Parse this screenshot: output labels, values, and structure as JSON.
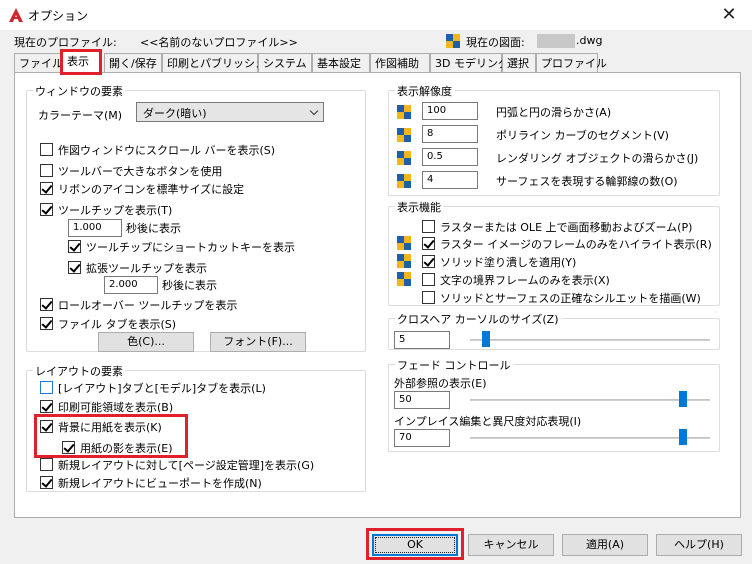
{
  "window": {
    "title": "オプション",
    "close_glyph": "✕"
  },
  "profile": {
    "label": "現在のプロファイル:",
    "value": "<<名前のないプロファイル>>",
    "drawing_label": "現在の図面:",
    "drawing_value": ".dwg"
  },
  "tabs": [
    {
      "label": "ファイル"
    },
    {
      "label": "表示"
    },
    {
      "label": "開く/保存"
    },
    {
      "label": "印刷とパブリッシュ"
    },
    {
      "label": "システム"
    },
    {
      "label": "基本設定"
    },
    {
      "label": "作図補助"
    },
    {
      "label": "3D モデリング"
    },
    {
      "label": "選択"
    },
    {
      "label": "プロファイル"
    }
  ],
  "window_elements": {
    "title": "ウィンドウの要素",
    "color_theme_label": "カラーテーマ(M)",
    "color_theme_value": "ダーク(暗い)",
    "items": [
      {
        "label": "作図ウィンドウにスクロール バーを表示(S)",
        "checked": false
      },
      {
        "label": "ツールバーで大きなボタンを使用",
        "checked": false
      },
      {
        "label": "リボンのアイコンを標準サイズに設定",
        "checked": true
      },
      {
        "label": "ツールチップを表示(T)",
        "checked": true
      }
    ],
    "tooltip_delay_value": "1.000",
    "tooltip_delay_suffix": "秒後に表示",
    "shortcut_label": "ツールチップにショートカットキーを表示",
    "extended_label": "拡張ツールチップを表示",
    "extended_delay_value": "2.000",
    "extended_delay_suffix": "秒後に表示",
    "rollover_label": "ロールオーバー ツールチップを表示",
    "file_tabs_label": "ファイル タブを表示(S)",
    "color_button": "色(C)...",
    "font_button": "フォント(F)..."
  },
  "layout_elements": {
    "title": "レイアウトの要素",
    "items": [
      {
        "label": "[レイアウト]タブと[モデル]タブを表示(L)",
        "checked": false
      },
      {
        "label": "印刷可能領域を表示(B)",
        "checked": true
      },
      {
        "label": "背景に用紙を表示(K)",
        "checked": true
      },
      {
        "label": "用紙の影を表示(E)",
        "checked": true
      },
      {
        "label": "新規レイアウトに対して[ページ設定管理]を表示(G)",
        "checked": false
      },
      {
        "label": "新規レイアウトにビューポートを作成(N)",
        "checked": true
      }
    ]
  },
  "display_resolution": {
    "title": "表示解像度",
    "items": [
      {
        "value": "100",
        "label": "円弧と円の滑らかさ(A)"
      },
      {
        "value": "8",
        "label": "ポリライン カーブのセグメント(V)"
      },
      {
        "value": "0.5",
        "label": "レンダリング オブジェクトの滑らかさ(J)"
      },
      {
        "value": "4",
        "label": "サーフェスを表現する輪郭線の数(O)"
      }
    ]
  },
  "display_performance": {
    "title": "表示機能",
    "items": [
      {
        "label": "ラスターまたは OLE 上で画面移動およびズーム(P)",
        "checked": false
      },
      {
        "label": "ラスター イメージのフレームのみをハイライト表示(R)",
        "checked": true
      },
      {
        "label": "ソリッド塗り潰しを適用(Y)",
        "checked": true
      },
      {
        "label": "文字の境界フレームのみを表示(X)",
        "checked": false
      },
      {
        "label": "ソリッドとサーフェスの正確なシルエットを描画(W)",
        "checked": false
      }
    ]
  },
  "crosshair": {
    "title": "クロスヘア カーソルのサイズ(Z)",
    "value": "5",
    "level_fraction": 0.05
  },
  "fade": {
    "title": "フェード コントロール",
    "xref_label": "外部参照の表示(E)",
    "xref_value": "50",
    "xref_level_fraction": 0.9,
    "inplace_label": "インプレイス編集と異尺度対応表現(I)",
    "inplace_value": "70",
    "inplace_level_fraction": 0.9
  },
  "footer": {
    "ok": "OK",
    "cancel": "キャンセル",
    "apply": "適用(A)",
    "help": "ヘルプ(H)"
  },
  "colors": {
    "accent": "#0078d7",
    "highlight": "#e0202a",
    "logo": "#d0262d"
  },
  "icons": {
    "cube": "display-cube-icon",
    "logo": "autocad-logo-icon"
  }
}
